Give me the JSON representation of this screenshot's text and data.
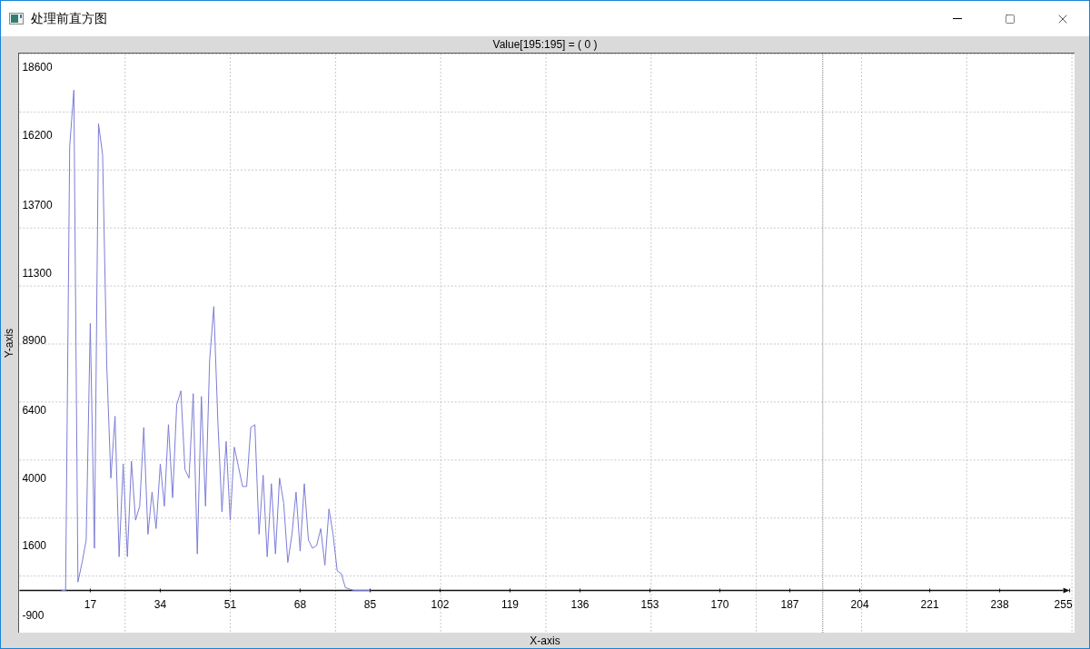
{
  "window": {
    "title": "处理前直方图"
  },
  "plot": {
    "chart_data": {
      "type": "line",
      "title": "Value[195:195] = ( 0 )",
      "xlabel": "X-axis",
      "ylabel": "Y-axis",
      "xlim": [
        0,
        255
      ],
      "ylim": [
        -1500,
        19100
      ],
      "xticks": [
        17,
        34,
        51,
        68,
        85,
        102,
        119,
        136,
        153,
        170,
        187,
        204,
        221,
        238,
        255
      ],
      "yticks": [
        -900,
        1600,
        4000,
        6400,
        8900,
        11300,
        13700,
        16200,
        18600
      ],
      "x": [
        10,
        11,
        12,
        13,
        14,
        15,
        16,
        17,
        18,
        19,
        20,
        21,
        22,
        23,
        24,
        25,
        26,
        27,
        28,
        29,
        30,
        31,
        32,
        33,
        34,
        35,
        36,
        37,
        38,
        39,
        40,
        41,
        42,
        43,
        44,
        45,
        46,
        47,
        48,
        49,
        50,
        51,
        52,
        53,
        54,
        55,
        56,
        57,
        58,
        59,
        60,
        61,
        62,
        63,
        64,
        65,
        66,
        67,
        68,
        69,
        70,
        71,
        72,
        73,
        74,
        75,
        76,
        77,
        78,
        79,
        80,
        81,
        82,
        83,
        84,
        85
      ],
      "series": [
        {
          "color": "#7b7bd6",
          "values": [
            0,
            0,
            15800,
            17800,
            300,
            1000,
            1800,
            9500,
            1500,
            16600,
            15500,
            8000,
            4000,
            6200,
            1200,
            4500,
            1200,
            4600,
            2500,
            3000,
            5800,
            2000,
            3500,
            2200,
            4500,
            3000,
            5900,
            3300,
            6600,
            7100,
            4300,
            4000,
            7000,
            1300,
            6900,
            3000,
            8200,
            10100,
            6000,
            2800,
            5300,
            2500,
            5100,
            4400,
            3700,
            3700,
            5800,
            5900,
            2000,
            4100,
            1200,
            3800,
            1300,
            4000,
            3100,
            1000,
            2000,
            3500,
            1400,
            3800,
            1800,
            1500,
            1600,
            2200,
            900,
            2900,
            2000,
            700,
            600,
            100,
            50,
            0,
            0,
            0,
            0,
            0
          ]
        }
      ],
      "ref_lines": [
        {
          "axis": "x",
          "value": 195
        }
      ],
      "grid": true
    }
  }
}
